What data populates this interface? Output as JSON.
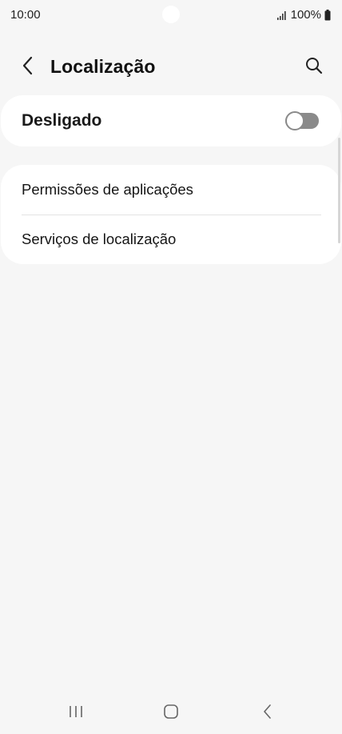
{
  "status_bar": {
    "time": "10:00",
    "battery": "100%",
    "icons": [
      "signal-icon",
      "battery-icon"
    ]
  },
  "header": {
    "title": "Localização",
    "back_icon": "chevron-left-icon",
    "search_icon": "search-icon"
  },
  "location_toggle": {
    "label": "Desligado",
    "enabled": false
  },
  "settings_list": {
    "items": [
      {
        "label": "Permissões de aplicações"
      },
      {
        "label": "Serviços de localização"
      }
    ]
  },
  "nav_bar": {
    "icons": [
      "recent-apps-icon",
      "home-icon",
      "back-icon"
    ]
  }
}
